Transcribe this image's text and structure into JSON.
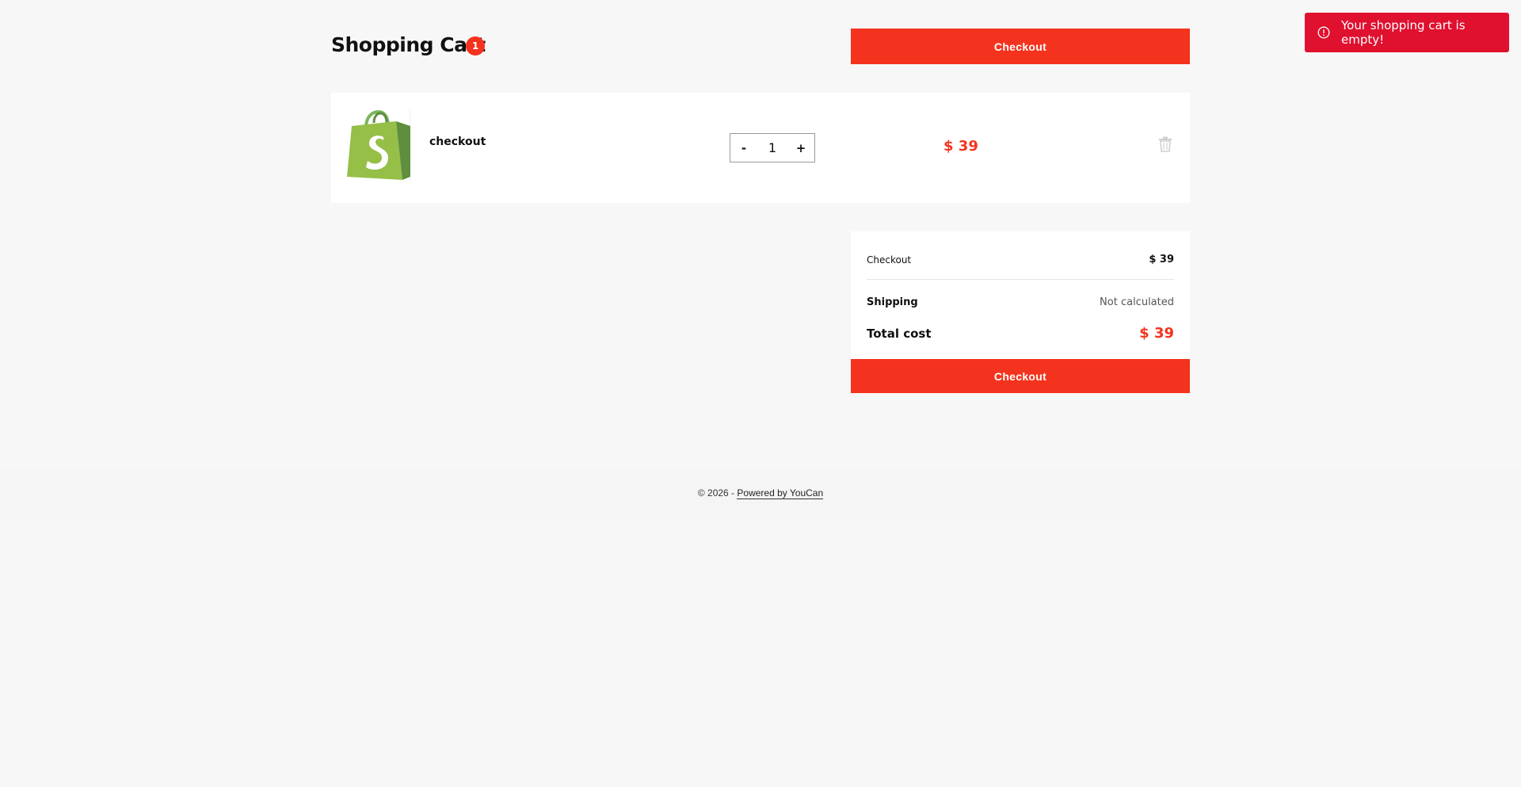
{
  "header": {
    "title": "Shopping Cart",
    "item_count": "1",
    "checkout_label": "Checkout"
  },
  "cart": {
    "items": [
      {
        "name": "checkout",
        "quantity": "1",
        "price": "$ 39",
        "decrement_label": "-",
        "increment_label": "+",
        "thumbnail_icon": "shopify-bag-icon",
        "remove_icon": "trash-icon"
      }
    ]
  },
  "summary": {
    "subtotal_label": "Checkout",
    "subtotal_value": "$ 39",
    "shipping_label": "Shipping",
    "shipping_value": "Not calculated",
    "total_label": "Total cost",
    "total_value": "$ 39",
    "checkout_label": "Checkout"
  },
  "footer": {
    "copyright": "© 2026 - ",
    "powered_by": "Powered by YouCan"
  },
  "toast": {
    "message": "Your shopping cart is empty!",
    "icon": "alert-circle-icon"
  },
  "colors": {
    "accent": "#f4331e",
    "toast_bg": "#e0102f",
    "page_bg": "#f7f7f7",
    "brand_green": "#95bf47"
  }
}
